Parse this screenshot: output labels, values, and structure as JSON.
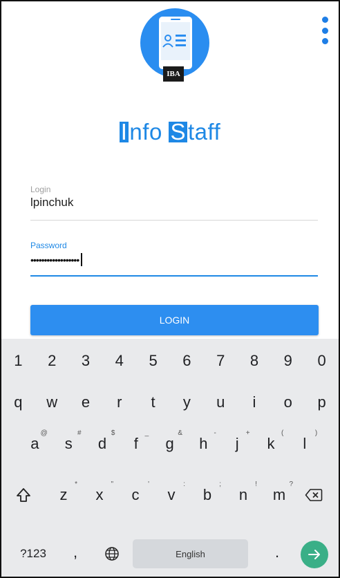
{
  "app": {
    "title_cap1": "I",
    "title_rest1": "nfo",
    "title_cap2": "S",
    "title_rest2": "taff",
    "logo_badge": "IBA"
  },
  "form": {
    "login_label": "Login",
    "login_value": "lpinchuk",
    "password_label": "Password",
    "password_value": "••••••••••••••••••",
    "login_button": "LOGIN"
  },
  "keyboard": {
    "numbers": [
      "1",
      "2",
      "3",
      "4",
      "5",
      "6",
      "7",
      "8",
      "9",
      "0"
    ],
    "row1": [
      "q",
      "w",
      "e",
      "r",
      "t",
      "y",
      "u",
      "i",
      "o",
      "p"
    ],
    "row2": [
      {
        "key": "a",
        "hint": "@"
      },
      {
        "key": "s",
        "hint": "#"
      },
      {
        "key": "d",
        "hint": "$"
      },
      {
        "key": "f",
        "hint": "_"
      },
      {
        "key": "g",
        "hint": "&"
      },
      {
        "key": "h",
        "hint": "-"
      },
      {
        "key": "j",
        "hint": "+"
      },
      {
        "key": "k",
        "hint": "("
      },
      {
        "key": "l",
        "hint": ")"
      }
    ],
    "row3": [
      {
        "key": "z",
        "hint": "*"
      },
      {
        "key": "x",
        "hint": "\""
      },
      {
        "key": "c",
        "hint": "'"
      },
      {
        "key": "v",
        "hint": ":"
      },
      {
        "key": "b",
        "hint": ";"
      },
      {
        "key": "n",
        "hint": "!"
      },
      {
        "key": "m",
        "hint": "?"
      }
    ],
    "symbols_key": "?123",
    "comma_key": ",",
    "space_label": "English",
    "period_key": "."
  },
  "colors": {
    "accent": "#1e88e5",
    "enter": "#3aaf87"
  }
}
